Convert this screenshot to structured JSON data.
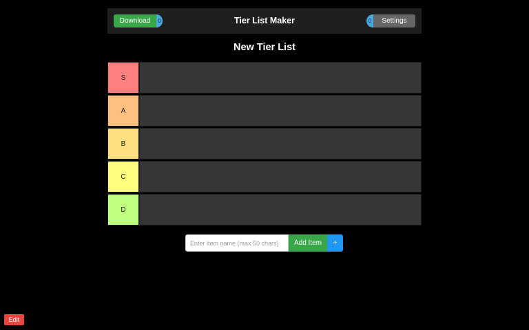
{
  "header": {
    "download_label": "Download",
    "badge_left": "0",
    "title": "Tier List Maker",
    "badge_right": "0",
    "settings_label": "Settings"
  },
  "list": {
    "title": "New Tier List"
  },
  "tiers": [
    {
      "label": "S",
      "color": "#ff7f7f"
    },
    {
      "label": "A",
      "color": "#ffbf7f"
    },
    {
      "label": "B",
      "color": "#ffdf7f"
    },
    {
      "label": "C",
      "color": "#ffff7f"
    },
    {
      "label": "D",
      "color": "#bfff7f"
    }
  ],
  "add_item": {
    "placeholder": "Enter item name (max 50 chars)",
    "value": "",
    "add_label": "Add Item",
    "plus_label": "+"
  },
  "footer": {
    "edit_label": "Edit"
  }
}
